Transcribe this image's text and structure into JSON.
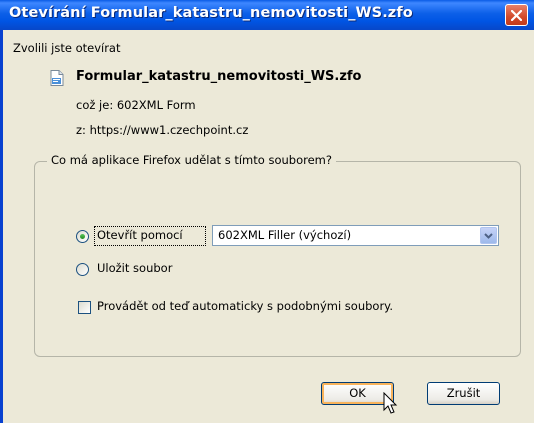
{
  "window": {
    "title": "Otevírání Formular_katastru_nemovitosti_WS.zfo"
  },
  "dialog": {
    "intro": "Zvolili jste otevírat",
    "file_name": "Formular_katastru_nemovitosti_WS.zfo",
    "type_line": "což je:  602XML Form",
    "from_line": "z:  https://www1.czechpoint.cz",
    "group_label": "Co má aplikace Firefox udělat s tímto souborem?",
    "open_with_label": "Otevřít pomocí",
    "open_with_app": "602XML Filler (výchozí)",
    "save_label": "Uložit soubor",
    "auto_label": "Provádět od teď automaticky s podobnými soubory.",
    "ok_label": "OK",
    "cancel_label": "Zrušit"
  },
  "state": {
    "selected_option": "open_with",
    "auto_checked": false
  },
  "icons": {
    "file": "document-icon",
    "close": "close-icon",
    "dropdown": "chevron-down-icon",
    "cursor": "mouse-pointer-icon"
  },
  "colors": {
    "titlebar": "#0055e4",
    "dialog_bg": "#ece9d8",
    "close_button": "#d24a2a",
    "default_button_glow": "#f8b35b"
  }
}
